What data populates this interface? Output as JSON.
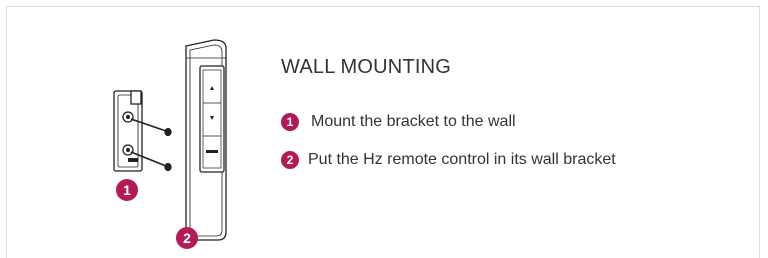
{
  "title": "WALL MOUNTING",
  "steps": [
    {
      "number": "1",
      "text": "Mount the bracket to the wall"
    },
    {
      "number": "2",
      "text": "Put the Hz remote control in its wall bracket"
    }
  ],
  "callouts": {
    "bracket": "1",
    "remote": "2"
  },
  "colors": {
    "accent": "#b31a58",
    "text": "#333333",
    "border": "#dcdcdc"
  }
}
